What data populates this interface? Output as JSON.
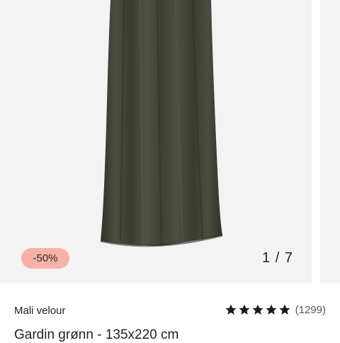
{
  "gallery": {
    "badge": "-50%",
    "counter": "1 / 7",
    "image": "green-velour-curtain"
  },
  "product": {
    "brand": "Mali velour",
    "title": "Gardin grønn - 135x220 cm",
    "rating": {
      "stars": 5,
      "max": 5,
      "count_label": "(1299)"
    }
  },
  "colors": {
    "badge_bg": "#f7b2a6",
    "curtain": "#3f4234",
    "gallery_bg": "#f3f3f3"
  }
}
